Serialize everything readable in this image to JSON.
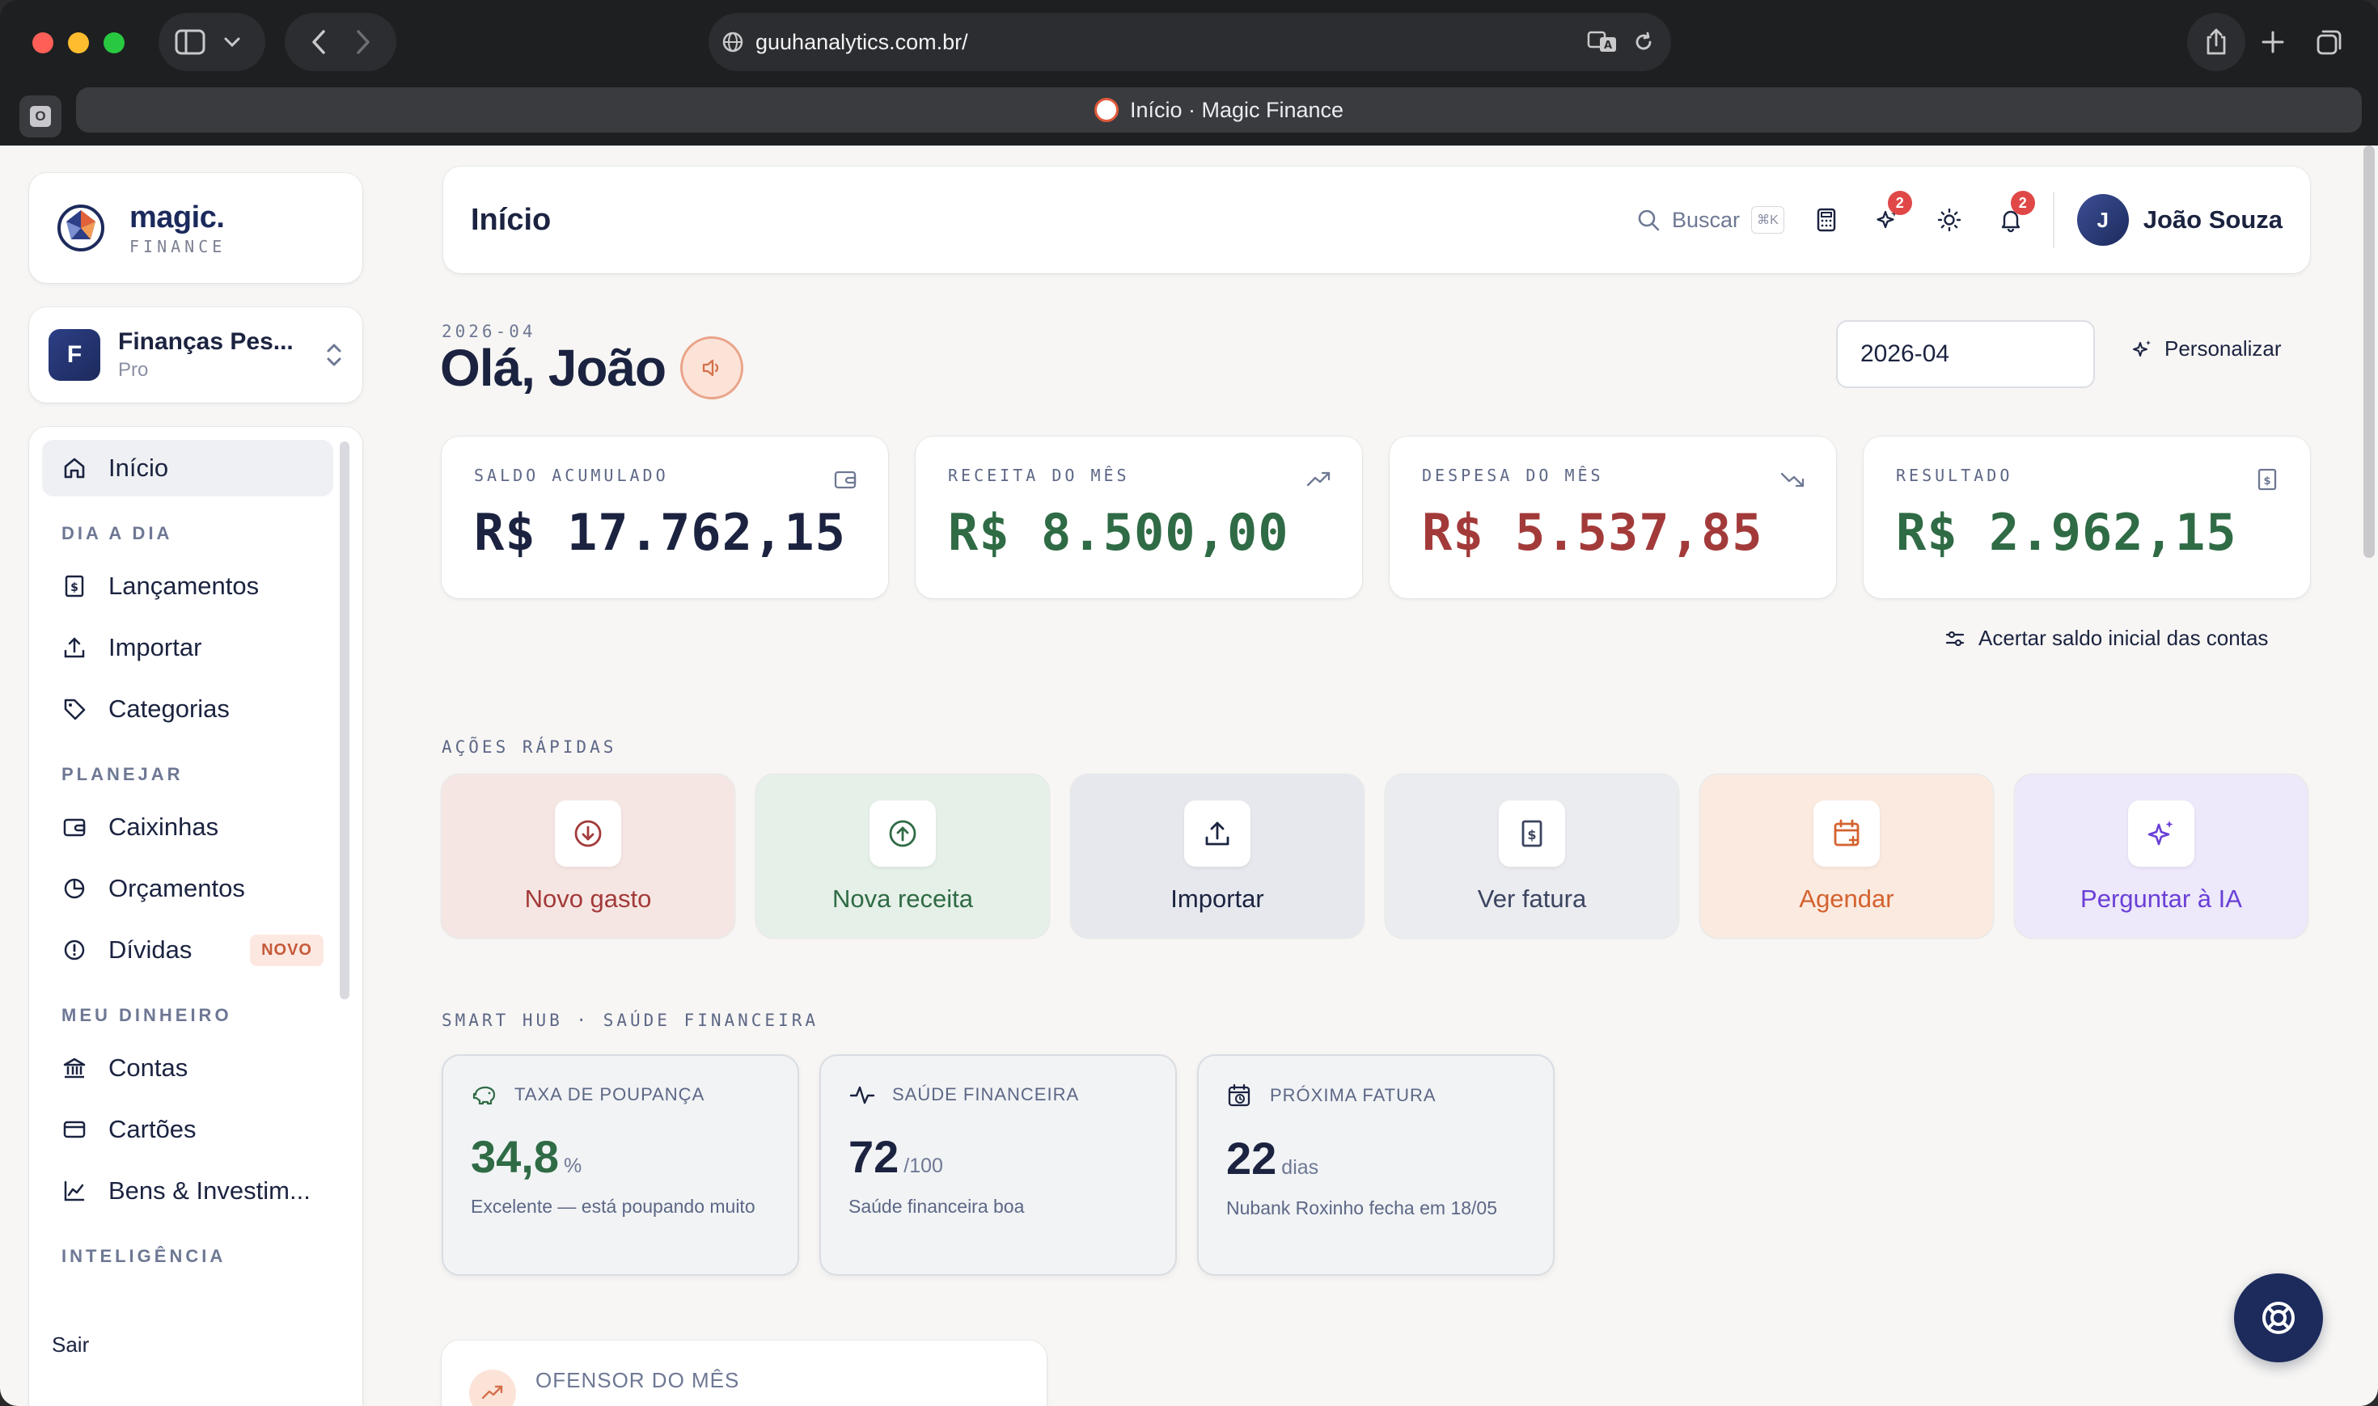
{
  "browser": {
    "url": "guuhanalytics.com.br/",
    "tab_title": "Início · Magic Finance",
    "tab_group_letter": "O"
  },
  "brand": {
    "name": "magic.",
    "subtitle": "FINANCE"
  },
  "workspace": {
    "initial": "F",
    "name": "Finanças Pes...",
    "plan": "Pro"
  },
  "nav": {
    "home": "Início",
    "sections": {
      "dia_a_dia": "DIA A DIA",
      "planejar": "PLANEJAR",
      "meu_dinheiro": "MEU DINHEIRO",
      "inteligencia": "INTELIGÊNCIA"
    },
    "items": {
      "lancamentos": "Lançamentos",
      "importar": "Importar",
      "categorias": "Categorias",
      "caixinhas": "Caixinhas",
      "orcamentos": "Orçamentos",
      "dividas": "Dívidas",
      "contas": "Contas",
      "cartoes": "Cartões",
      "bens": "Bens & Investim..."
    },
    "novo_badge": "NOVO",
    "logout": "Sair"
  },
  "header": {
    "title": "Início",
    "search_label": "Buscar",
    "search_shortcut": "⌘K",
    "ai_badge": "2",
    "notifications_badge": "2",
    "user_initial": "J",
    "user_name": "João Souza"
  },
  "greeting": {
    "period_label": "2026-04",
    "text": "Olá, João",
    "period_value": "2026-04",
    "customize": "Personalizar"
  },
  "stats": [
    {
      "label": "SALDO ACUMULADO",
      "value": "R$ 17.762,15",
      "color": "#1b2340",
      "icon": "wallet-icon"
    },
    {
      "label": "RECEITA DO MÊS",
      "value": "R$ 8.500,00",
      "color": "#2f6b45",
      "icon": "trending-up-icon"
    },
    {
      "label": "DESPESA DO MÊS",
      "value": "R$ 5.537,85",
      "color": "#a33a3a",
      "icon": "trending-down-icon"
    },
    {
      "label": "RESULTADO",
      "value": "R$ 2.962,15",
      "color": "#2f6b45",
      "icon": "receipt-icon"
    }
  ],
  "adjust_balance": "Acertar saldo inicial das contas",
  "quick_actions": {
    "title": "AÇÕES RÁPIDAS",
    "items": [
      {
        "label": "Novo gasto",
        "icon": "arrow-down-circle-icon",
        "bg": "#f6e6e3",
        "color": "#a33a3a"
      },
      {
        "label": "Nova receita",
        "icon": "arrow-up-circle-icon",
        "bg": "#e5f0e8",
        "color": "#2f6b45"
      },
      {
        "label": "Importar",
        "icon": "upload-icon",
        "bg": "#e6e8ee",
        "color": "#1b2340"
      },
      {
        "label": "Ver fatura",
        "icon": "receipt-icon",
        "bg": "#ebecf0",
        "color": "#3b4460"
      },
      {
        "label": "Agendar",
        "icon": "calendar-icon",
        "bg": "#fbeae0",
        "color": "#d4622e"
      },
      {
        "label": "Perguntar à IA",
        "icon": "sparkles-icon",
        "bg": "#ede8fa",
        "color": "#6a3fd6"
      }
    ]
  },
  "smart_hub": {
    "title": "SMART HUB · SAÚDE FINANCEIRA",
    "cards": [
      {
        "label": "TAXA DE POUPANÇA",
        "value": "34,8",
        "unit": "%",
        "desc": "Excelente — está poupando muito",
        "color": "#2f6b45",
        "icon": "piggy-bank-icon"
      },
      {
        "label": "SAÚDE FINANCEIRA",
        "value": "72",
        "unit": "/100",
        "desc": "Saúde financeira boa",
        "color": "#1b2340",
        "icon": "pulse-icon"
      },
      {
        "label": "PRÓXIMA FATURA",
        "value": "22",
        "unit": "dias",
        "desc": "Nubank Roxinho fecha em 18/05",
        "color": "#1b2340",
        "icon": "calendar-clock-icon"
      }
    ]
  },
  "offender": {
    "title": "OFENSOR DO MÊS"
  }
}
